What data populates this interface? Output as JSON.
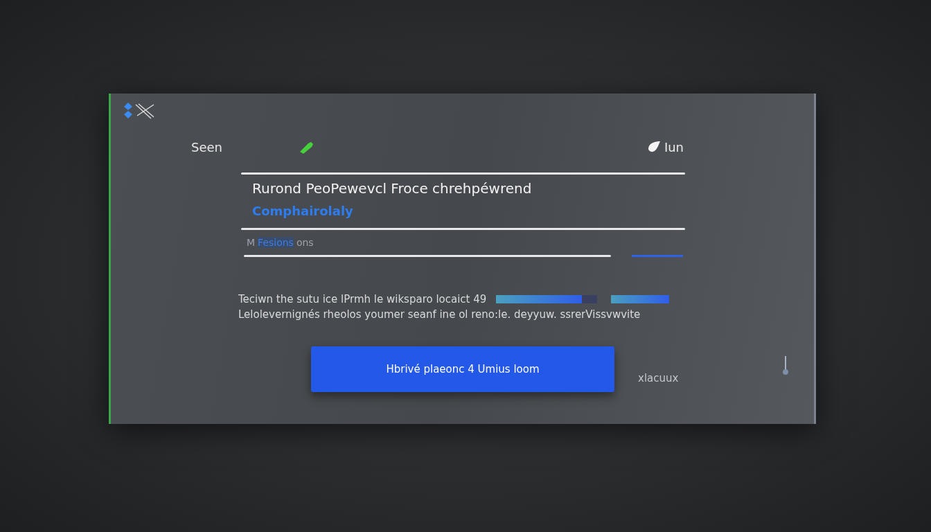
{
  "header": {
    "label": "Seen",
    "status_text": "Iun"
  },
  "field": {
    "value": "Rurond  PeoPewevcl Froce chrehpéwrend",
    "link": "Comphairolaly"
  },
  "filter": {
    "prefix": "M",
    "tag": "Fesions",
    "suffix": "ons"
  },
  "message": {
    "lines": [
      "Teciwn the sutu ice lPrmh le wiksparo locaict 49",
      "Lelolevernignés rheolos youmer seanf ine ol reno:le. deyyuw. ssrerVissvwvite"
    ],
    "progress": [
      {
        "level": 0.85
      },
      {
        "level": 1
      }
    ]
  },
  "button": {
    "label": "Hbrivé plaeonc 4 Umius loom"
  },
  "footer_text": "xlacuux"
}
